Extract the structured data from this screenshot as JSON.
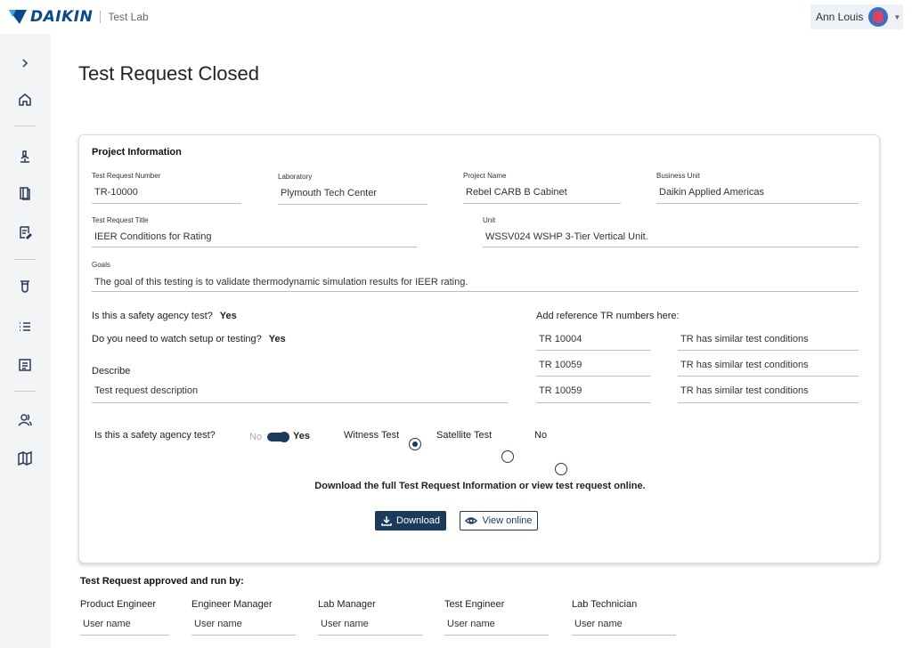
{
  "header": {
    "brand": "DAIKIN",
    "app_name": "Test Lab",
    "user_name": "Ann Louis",
    "brand_color": "#0a4a8c"
  },
  "sidebar": {
    "expand_icon": "chevron-right-icon",
    "items": [
      {
        "icon": "home-icon"
      },
      {
        "icon": "microscope-icon"
      },
      {
        "icon": "book-icon"
      },
      {
        "icon": "edit-document-icon"
      },
      {
        "icon": "test-tube-icon"
      },
      {
        "icon": "list-icon"
      },
      {
        "icon": "document-icon"
      },
      {
        "icon": "users-icon"
      },
      {
        "icon": "map-icon"
      }
    ]
  },
  "page": {
    "title": "Test Request Closed"
  },
  "project": {
    "section_title": "Project Information",
    "test_request_number": {
      "label": "Test Request Number",
      "value": "TR-10000"
    },
    "laboratory": {
      "label": "Laboratory",
      "value": "Plymouth Tech Center"
    },
    "project_name": {
      "label": "Project Name",
      "value": "Rebel CARB B Cabinet"
    },
    "business_unit": {
      "label": "Business Unit",
      "value": "Daikin Applied Americas"
    },
    "test_request_title": {
      "label": "Test  Request Title",
      "value": "IEER Conditions for Rating"
    },
    "unit": {
      "label": "Unit",
      "value": "WSSV024 WSHP 3-Tier Vertical Unit."
    },
    "goals": {
      "label": "Goals",
      "value": "The goal of this testing is to validate thermodynamic simulation results for IEER rating."
    },
    "safety_q": {
      "label": "Is this a safety agency test?",
      "value": "Yes"
    },
    "watch_q": {
      "label": "Do you need to watch setup or testing?",
      "value": "Yes"
    },
    "describe": {
      "label": "Describe",
      "value": "Test request description"
    },
    "references": {
      "label": "Add reference TR numbers here:",
      "rows": [
        {
          "tr": "TR 10004",
          "note": "TR has similar test conditions"
        },
        {
          "tr": "TR 10059",
          "note": "TR has similar test conditions"
        },
        {
          "tr": "TR 10059",
          "note": "TR has similar test conditions"
        }
      ]
    },
    "options": {
      "safety_label": "Is this a safety agency test?",
      "toggle_off": "No",
      "toggle_on": "Yes",
      "witness": "Witness Test",
      "satellite": "Satellite Test",
      "no": "No",
      "selected": "Witness Test"
    },
    "download_text": "Download the full Test Request Information or view test request online.",
    "download_button": "Download",
    "view_button": "View online"
  },
  "approvals": {
    "title": "Test Request approved and run by:",
    "roles": [
      {
        "role": "Product Engineer",
        "user": "User name"
      },
      {
        "role": "Engineer Manager",
        "user": "User name"
      },
      {
        "role": "Lab Manager",
        "user": "User name"
      },
      {
        "role": "Test Engineer",
        "user": "User name"
      },
      {
        "role": "Lab Technician",
        "user": "User name"
      }
    ]
  },
  "colors": {
    "primary": "#1b3a5c",
    "sidebar_bg": "#f3f4f6"
  }
}
